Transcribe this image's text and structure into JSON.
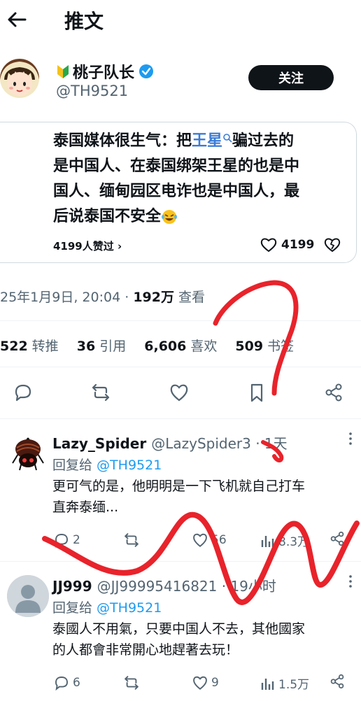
{
  "header": {
    "title": "推文"
  },
  "author": {
    "name": "桃子队长",
    "handle": "@TH9521",
    "follow_label": "关注"
  },
  "quote": {
    "line1_pre": "泰国媒体很生气：把",
    "line1_link": "王星",
    "line1_post": "骗过去的",
    "line2": "是中国人、在泰国绑架王星的也是中",
    "line3": "国人、缅甸园区电诈也是中国人，最",
    "line4": "后说泰国不安全",
    "likers": "4199人赞过 ›",
    "likes": "4199"
  },
  "tweet": {
    "date": "25年1月9日, 20:04 · ",
    "views_value": "192万",
    "views_label": " 查看"
  },
  "stats": {
    "retweets_value": "522",
    "retweets_label": "转推",
    "quotes_value": "36",
    "quotes_label": "引用",
    "likes_value": "6,606",
    "likes_label": "喜欢",
    "bookmarks_value": "509",
    "bookmarks_label": "书签"
  },
  "replies": [
    {
      "name": "Lazy_Spider",
      "handle": "@LazySpider3 · 1天",
      "reply_to_label": "回复给 ",
      "reply_to_handle": "@TH9521",
      "text_line1": "更可气的是，他明明是一下飞机就自己打车",
      "text_line2": "直奔泰缅...",
      "comments": "2",
      "likes": "56",
      "views": "8.3万"
    },
    {
      "name": "JJ999",
      "handle": "@JJ99995416821 · 19小时",
      "reply_to_label": "回复给 ",
      "reply_to_handle": "@TH9521",
      "text_line1": "泰國人不用氣，只要中国人不去，其他國家",
      "text_line2": "的人都會非常開心地趕著去玩！",
      "comments": "6",
      "likes": "9",
      "views": "1.5万"
    }
  ],
  "colors": {
    "accent": "#1d9bf0",
    "scribble": "#e8232b",
    "text": "#0f1419",
    "muted": "#536471"
  }
}
